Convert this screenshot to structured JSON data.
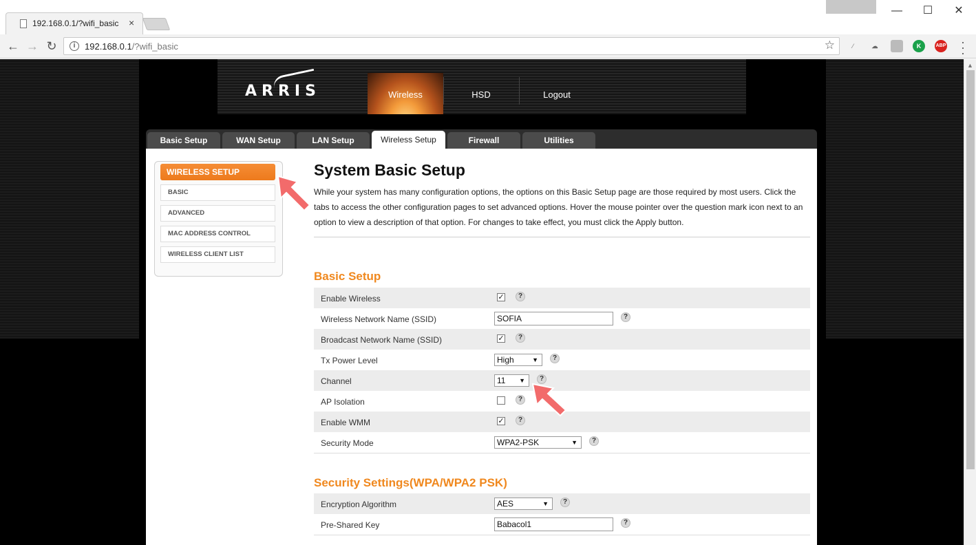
{
  "browser": {
    "tab_title": "192.168.0.1/?wifi_basic",
    "tab_close": "×",
    "url_host": "192.168.0.1",
    "url_path": "/?wifi_basic",
    "window_min": "—",
    "window_max": "☐",
    "window_close": "✕",
    "ext_abp": "ABP",
    "ext_k": "K"
  },
  "header": {
    "logo": "ARRIS",
    "nav": [
      {
        "label": "Wireless",
        "active": true
      },
      {
        "label": "HSD"
      },
      {
        "label": "Logout"
      }
    ]
  },
  "tabs": [
    {
      "label": "Basic Setup"
    },
    {
      "label": "WAN Setup"
    },
    {
      "label": "LAN Setup"
    },
    {
      "label": "Wireless Setup",
      "active": true
    },
    {
      "label": "Firewall"
    },
    {
      "label": "Utilities"
    }
  ],
  "sidenav": {
    "heading": "WIRELESS SETUP",
    "items": [
      {
        "label": "BASIC"
      },
      {
        "label": "ADVANCED"
      },
      {
        "label": "MAC ADDRESS CONTROL"
      },
      {
        "label": "WIRELESS CLIENT LIST"
      }
    ]
  },
  "main": {
    "title": "System Basic Setup",
    "intro": "While your system has many configuration options, the options on this Basic Setup page are those required by most users. Click the tabs to access the other configuration pages to set advanced options. Hover the mouse pointer over the question mark icon next to an option to view a description of that option. For changes to take effect, you must click the Apply button.",
    "help_glyph": "?",
    "basic_setup": {
      "title": "Basic Setup",
      "enable_wireless": {
        "label": "Enable Wireless",
        "checked": true
      },
      "ssid": {
        "label": "Wireless Network Name (SSID)",
        "value": "SOFIA"
      },
      "broadcast_ssid": {
        "label": "Broadcast Network Name (SSID)",
        "checked": true
      },
      "tx_power": {
        "label": "Tx Power Level",
        "value": "High"
      },
      "channel": {
        "label": "Channel",
        "value": "11"
      },
      "ap_isolation": {
        "label": "AP Isolation",
        "checked": false
      },
      "enable_wmm": {
        "label": "Enable WMM",
        "checked": true
      },
      "security_mode": {
        "label": "Security Mode",
        "value": "WPA2-PSK"
      }
    },
    "security_settings": {
      "title": "Security Settings(WPA/WPA2 PSK)",
      "encryption": {
        "label": "Encryption Algorithm",
        "value": "AES"
      },
      "psk": {
        "label": "Pre-Shared Key",
        "value": "Babacol1"
      }
    }
  },
  "colors": {
    "accent": "#f0881e",
    "annotation_arrow": "#f26b6b"
  }
}
